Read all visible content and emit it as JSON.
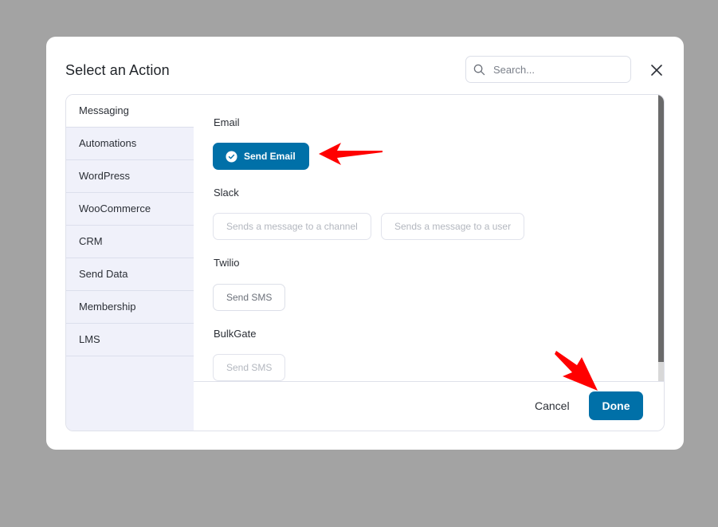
{
  "modal": {
    "title": "Select an Action",
    "search": {
      "placeholder": "Search...",
      "value": ""
    },
    "close_icon": "close-icon"
  },
  "sidebar": {
    "items": [
      {
        "label": "Messaging",
        "active": true
      },
      {
        "label": "Automations",
        "active": false
      },
      {
        "label": "WordPress",
        "active": false
      },
      {
        "label": "WooCommerce",
        "active": false
      },
      {
        "label": "CRM",
        "active": false
      },
      {
        "label": "Send Data",
        "active": false
      },
      {
        "label": "Membership",
        "active": false
      },
      {
        "label": "LMS",
        "active": false
      }
    ]
  },
  "groups": [
    {
      "label": "Email",
      "actions": [
        {
          "label": "Send Email",
          "state": "selected",
          "icon": "check-circle-icon"
        }
      ]
    },
    {
      "label": "Slack",
      "actions": [
        {
          "label": "Sends a message to a channel",
          "state": "disabled"
        },
        {
          "label": "Sends a message to a user",
          "state": "disabled"
        }
      ]
    },
    {
      "label": "Twilio",
      "actions": [
        {
          "label": "Send SMS",
          "state": "enabled"
        }
      ]
    },
    {
      "label": "BulkGate",
      "actions": [
        {
          "label": "Send SMS",
          "state": "disabled"
        }
      ]
    }
  ],
  "footer": {
    "cancel_label": "Cancel",
    "done_label": "Done"
  },
  "colors": {
    "primary": "#0070a8",
    "overlay": "#a3a3a3",
    "sidebar_bg": "#f0f1fa",
    "annotation_arrow": "#ff0000"
  }
}
